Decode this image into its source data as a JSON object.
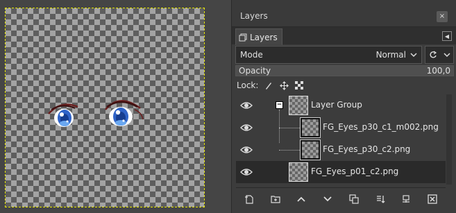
{
  "dock": {
    "title": "Layers",
    "close_glyph": "×"
  },
  "tab": {
    "label": "Layers",
    "icon": "layers-icon"
  },
  "mode": {
    "label": "Mode",
    "value": "Normal"
  },
  "opacity": {
    "label": "Opacity",
    "value": "100,0",
    "fraction": 1.0
  },
  "lock": {
    "label": "Lock:",
    "icons": [
      "paintbrush-lock-icon",
      "move-lock-icon",
      "alpha-lock-icon"
    ]
  },
  "layers": [
    {
      "name": "Layer Group",
      "visible": true,
      "type": "group",
      "expanded": true,
      "selected": false
    },
    {
      "name": "FG_Eyes_p30_c1_m002.png",
      "visible": true,
      "type": "layer",
      "child": true,
      "selected": false
    },
    {
      "name": "FG_Eyes_p30_c2.png",
      "visible": true,
      "type": "layer",
      "child": true,
      "selected": false
    },
    {
      "name": "FG_Eyes_p01_c2.png",
      "visible": true,
      "type": "layer",
      "child": false,
      "selected": true
    }
  ],
  "collapse_glyph": "−",
  "bottom_bar": [
    "new-layer-icon",
    "new-group-icon",
    "raise-layer-icon",
    "lower-layer-icon",
    "duplicate-layer-icon",
    "merge-down-icon",
    "anchor-icon",
    "delete-layer-icon"
  ],
  "colors": {
    "selection_marching_ants": "#e6e600",
    "selected_row": "#2a2a2a"
  }
}
